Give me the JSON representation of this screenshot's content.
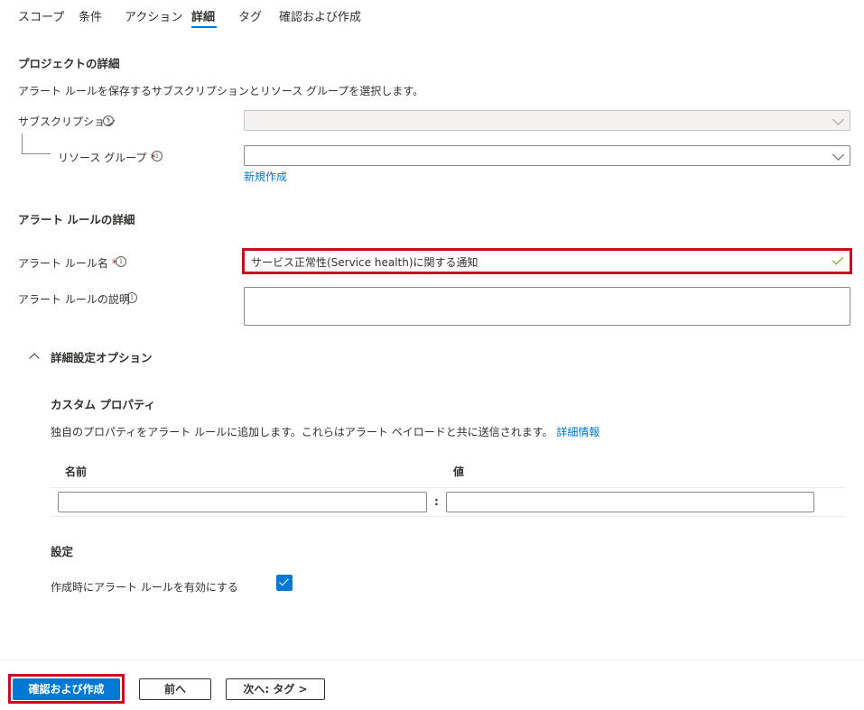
{
  "tabs": [
    {
      "label": "スコープ"
    },
    {
      "label": "条件"
    },
    {
      "label": "アクション"
    },
    {
      "label": "詳細"
    },
    {
      "label": "タグ"
    },
    {
      "label": "確認および作成"
    }
  ],
  "project": {
    "title": "プロジェクトの詳細",
    "description": "アラート ルールを保存するサブスクリプションとリソース グループを選択します。",
    "subscription_label": "サブスクリプション",
    "subscription_value": "",
    "resource_group_label": "リソース グループ",
    "resource_group_value": "",
    "required_mark": "*",
    "create_new_link": "新規作成"
  },
  "rule": {
    "title": "アラート ルールの詳細",
    "name_label": "アラート ルール名",
    "name_value": "サービス正常性(Service health)に関する通知",
    "description_label": "アラート ルールの説明",
    "description_value": ""
  },
  "advanced": {
    "toggle_label": "詳細設定オプション",
    "custom_props_title": "カスタム プロパティ",
    "custom_props_desc": "独自のプロパティをアラート ルールに追加します。これらはアラート ペイロードと共に送信されます。",
    "learn_more_link": "詳細情報",
    "col_name": "名前",
    "col_value": "値",
    "separator": ":",
    "name_value": "",
    "value_value": "",
    "settings_title": "設定",
    "enable_label": "作成時にアラート ルールを有効にする",
    "enable_checked": true
  },
  "footer": {
    "review_create": "確認および作成",
    "previous": "前へ",
    "next": "次へ: タグ >"
  },
  "colors": {
    "accent": "#0078d4",
    "highlight": "#c50f1f",
    "valid": "#57a300"
  }
}
